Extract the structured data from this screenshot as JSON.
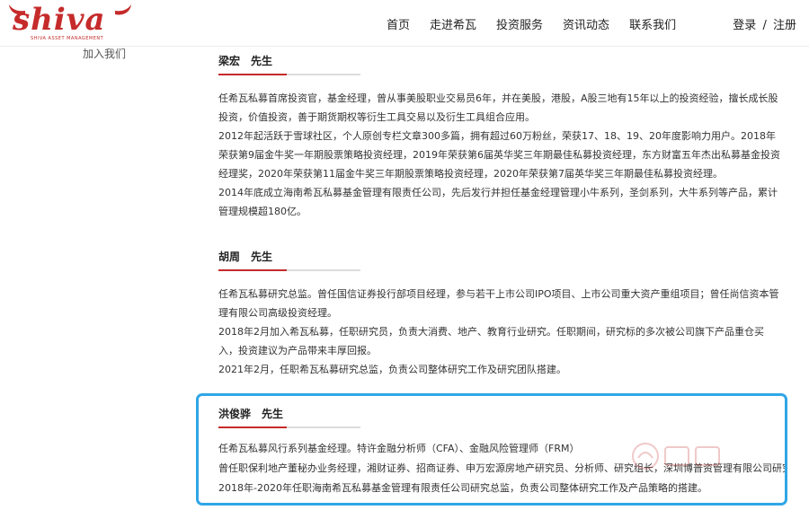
{
  "header": {
    "logo_text": "shiva",
    "logo_subtext": "SHIVA ASSET MANAGEMENT",
    "nav": [
      "首页",
      "走进希瓦",
      "投资服务",
      "资讯动态",
      "联系我们"
    ],
    "login": "登录",
    "separator": "/",
    "register": "注册"
  },
  "sidebar": {
    "join_label": "加入我们"
  },
  "profiles": [
    {
      "name": "梁宏",
      "honorific": "先生",
      "paragraphs": [
        "任希瓦私募首席投资官，基金经理，曾从事美股职业交易员6年，并在美股，港股，A股三地有15年以上的投资经验，擅长成长股投资，价值投资，善于期货期权等衍生工具交易以及衍生工具组合应用。",
        "2012年起活跃于雪球社区，个人原创专栏文章300多篇，拥有超过60万粉丝，荣获17、18、19、20年度影响力用户。2018年荣获第9届金牛奖一年期股票策略投资经理，2019年荣获第6届英华奖三年期最佳私募投资经理，东方财富五年杰出私募基金投资经理奖，2020年荣获第11届金牛奖三年期股票策略投资经理，2020年荣获第7届英华奖三年期最佳私募投资经理。",
        "2014年底成立海南希瓦私募基金管理有限责任公司，先后发行并担任基金经理管理小牛系列，圣剑系列，大牛系列等产品，累计管理规模超180亿。"
      ]
    },
    {
      "name": "胡周",
      "honorific": "先生",
      "paragraphs": [
        "任希瓦私募研究总监。曾任国信证券投行部项目经理，参与若干上市公司IPO项目、上市公司重大资产重组项目；曾任尚信资本管理有限公司高级投资经理。",
        "2018年2月加入希瓦私募，任职研究员，负责大消费、地产、教育行业研究。任职期间，研究标的多次被公司旗下产品重仓买入，投资建议为产品带来丰厚回报。",
        "2021年2月，任职希瓦私募研究总监，负责公司整体研究工作及研究团队搭建。"
      ]
    },
    {
      "name": "洪俊骅",
      "honorific": "先生",
      "paragraphs": [
        "任希瓦私募风行系列基金经理。特许金融分析师（CFA）、金融风险管理师（FRM）",
        "曾任职保利地产董秘办业务经理，湘财证券、招商证券、申万宏源房地产研究员、分析师、研究组长，深圳博普资管理有限公司研究员。",
        "2018年-2020年任职海南希瓦私募基金管理有限责任公司研究总监，负责公司整体研究工作及产品策略的搭建。"
      ]
    }
  ],
  "colors": {
    "brand": "#c62b2b",
    "highlight": "#2fa6e6"
  }
}
